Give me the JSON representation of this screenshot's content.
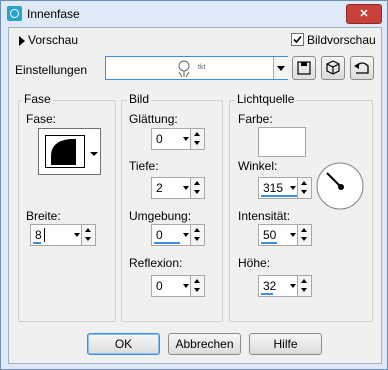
{
  "window": {
    "title": "Innenfase",
    "close_glyph": "✕"
  },
  "top": {
    "preview_label": "Vorschau",
    "bildvorschau_label": "Bildvorschau",
    "bildvorschau_checked": true,
    "einstellungen_label": "Einstellungen",
    "preset_logo_text": "tkt"
  },
  "fase_group": {
    "title": "Fase",
    "fase_label": "Fase:",
    "breite_label": "Breite:",
    "breite_value": "8"
  },
  "bild_group": {
    "title": "Bild",
    "glaettung_label": "Glättung:",
    "glaettung_value": "0",
    "tiefe_label": "Tiefe:",
    "tiefe_value": "2",
    "umgebung_label": "Umgebung:",
    "umgebung_value": "0",
    "reflexion_label": "Reflexion:",
    "reflexion_value": "0"
  },
  "licht_group": {
    "title": "Lichtquelle",
    "farbe_label": "Farbe:",
    "farbe_color": "#ffffff",
    "winkel_label": "Winkel:",
    "winkel_value": "315",
    "intensitaet_label": "Intensität:",
    "intensitaet_value": "50",
    "hoehe_label": "Höhe:",
    "hoehe_value": "32"
  },
  "buttons": {
    "ok": "OK",
    "abbrechen": "Abbrechen",
    "hilfe": "Hilfe"
  },
  "colors": {
    "accent": "#3d8ee0",
    "close": "#c8413a",
    "title_bg": "#dfe9f5"
  }
}
